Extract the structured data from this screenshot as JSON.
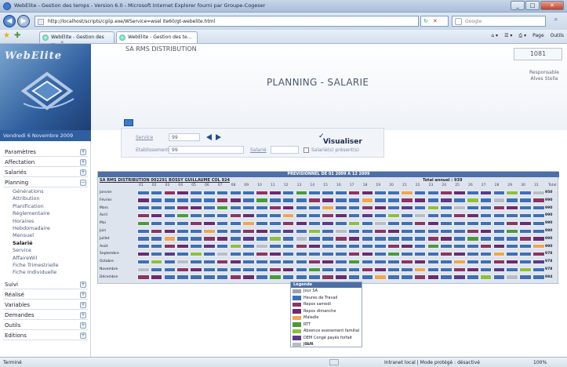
{
  "window": {
    "title": "WebElite - Gestion des temps - Version 6.0 - Microsoft Internet Explorer fourni par Groupe-Cogeser"
  },
  "address": {
    "url": "http://localhost/scripts/cgiip.exe/WService=wsel ite60/gt-webelite.html",
    "search_placeholder": "Google"
  },
  "tabs": [
    {
      "label": "WebElite - Gestion des ..."
    },
    {
      "label": "WebElite - Gestion des te..."
    }
  ],
  "cmdbar": {
    "page": "Page",
    "tools": "Outils"
  },
  "header": {
    "company": "SA RMS DISTRIBUTION",
    "title": "PLANNING - SALARIE",
    "code": "1081",
    "role_line1": "Responsable",
    "role_line2": "Alves Stella"
  },
  "logo": {
    "text": "WebElite"
  },
  "date": "Vendredi 6 Novembre 2009",
  "menu": [
    {
      "label": "Paramètres"
    },
    {
      "label": "Affectation"
    },
    {
      "label": "Salariés"
    },
    {
      "label": "Planning"
    }
  ],
  "submenu": [
    "Générations",
    "Attribution",
    "Planification",
    "Réglementaire",
    "Horaires",
    "Hebdomadaire",
    "Mensuel",
    "Salarié",
    "Service",
    "AffaireWil",
    "Fiche Trimestrielle",
    "Fiche Individuelle"
  ],
  "menu2": [
    {
      "label": "Suivi"
    },
    {
      "label": "Réalisé"
    },
    {
      "label": "Variables"
    },
    {
      "label": "Demandes"
    },
    {
      "label": "Outils"
    },
    {
      "label": "Editions"
    }
  ],
  "form": {
    "service_label": "Service",
    "service_value": "99",
    "etab_label": "Etablissement",
    "etab_value": "99",
    "salarie_label": "Salarié",
    "present_label": "Salarié(s) présent(s)",
    "visualiser": "Visualiser"
  },
  "table": {
    "title": "PREVISIONNEL DE 01 2009 A 12 2009",
    "employee": "SA RMS DISTRIBUTION 002291 BOSSY GUILLAUME COL 924",
    "total": "Total annuel : 939",
    "total_header": "Total",
    "days": [
      "01",
      "02",
      "03",
      "04",
      "05",
      "06",
      "07",
      "08",
      "09",
      "10",
      "11",
      "12",
      "13",
      "14",
      "15",
      "16",
      "17",
      "18",
      "19",
      "20",
      "21",
      "22",
      "23",
      "24",
      "25",
      "26",
      "27",
      "28",
      "29",
      "30",
      "31"
    ],
    "months": [
      {
        "name": "Janvier",
        "total": "950"
      },
      {
        "name": "Février",
        "total": "990"
      },
      {
        "name": "Mars",
        "total": "990"
      },
      {
        "name": "Avril",
        "total": "990"
      },
      {
        "name": "Mai",
        "total": "990"
      },
      {
        "name": "Juin",
        "total": "980"
      },
      {
        "name": "Juillet",
        "total": "990"
      },
      {
        "name": "Août",
        "total": "990"
      },
      {
        "name": "Septembre",
        "total": "978"
      },
      {
        "name": "Octobre",
        "total": "978"
      },
      {
        "name": "Novembre",
        "total": "978"
      },
      {
        "name": "Décembre",
        "total": "984"
      }
    ]
  },
  "legend": {
    "title": "Légende",
    "items": [
      {
        "label": "Jour SA",
        "color": "#9aa3ae"
      },
      {
        "label": "Heures de Travail",
        "color": "#3f6fb5"
      },
      {
        "label": "Repos samedi",
        "color": "#8c3462"
      },
      {
        "label": "Repos dimanche",
        "color": "#6a2b6f"
      },
      {
        "label": "Maladie",
        "color": "#f2a64a"
      },
      {
        "label": "RTT",
        "color": "#4a9a3a"
      },
      {
        "label": "Absence evenement familial",
        "color": "#8fbf3a"
      },
      {
        "label": "DEM Congé payés forfait jours",
        "color": "#5a3a8a"
      },
      {
        "label": "JOUR",
        "color": "#b8bcc4"
      }
    ]
  },
  "colors": {
    "work": "#3f6fb5",
    "sat": "#8c3462",
    "sun": "#6a2b6f",
    "sick": "#f2a64a",
    "rtt": "#4a9a3a",
    "fam": "#8fbf3a",
    "cp": "#5a3a8a",
    "ferie": "#b8bcc4"
  },
  "status": {
    "left": "Terminé",
    "zone": "Intranet local | Mode protégé : désactivé",
    "zoom": "100%"
  }
}
